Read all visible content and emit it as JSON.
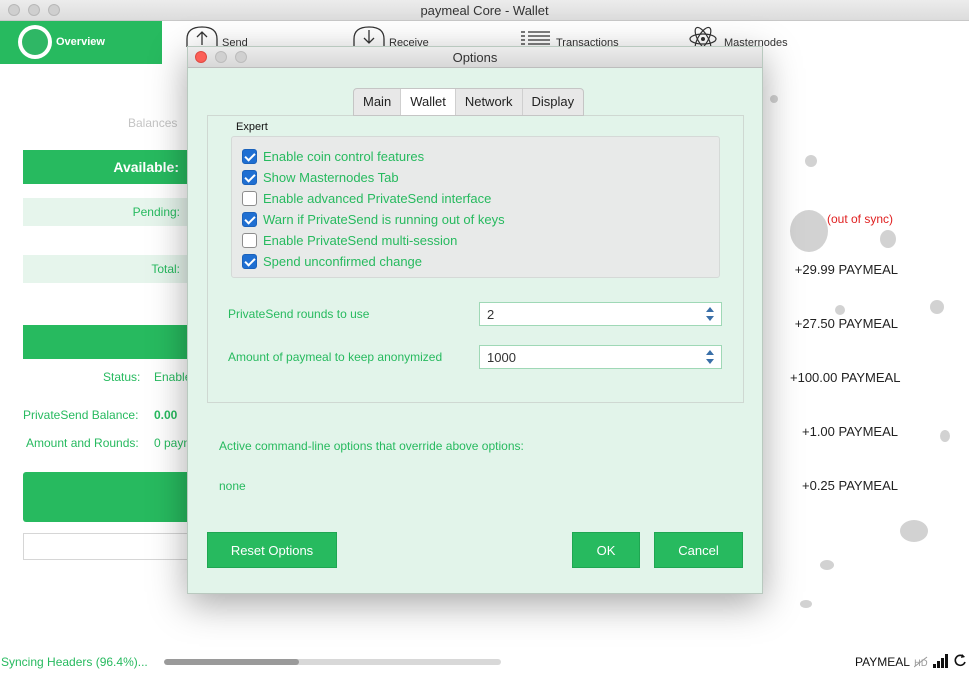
{
  "window": {
    "title": "paymeal Core - Wallet"
  },
  "toolbar": {
    "overview": "Overview",
    "send": "Send",
    "receive": "Receive",
    "transactions": "Transactions",
    "masternodes": "Masternodes"
  },
  "overview": {
    "balances_label": "Balances",
    "available_label": "Available:",
    "pending_label": "Pending:",
    "total_label": "Total:",
    "status_label": "Status:",
    "status_value": "Enable",
    "ps_balance_label": "PrivateSend Balance:",
    "ps_balance_value": "0.00",
    "amount_rounds_label": "Amount and Rounds:",
    "amount_rounds_value": "0 payn",
    "out_of_sync": "(out of sync)",
    "transactions": [
      "+29.99 PAYMEAL",
      "+27.50 PAYMEAL",
      "+100.00 PAYMEAL",
      "+1.00 PAYMEAL",
      "+0.25 PAYMEAL"
    ]
  },
  "statusbar": {
    "sync_text": "Syncing Headers (96.4%)...",
    "sync_progress": 0.4,
    "unit": "PAYMEAL"
  },
  "dialog": {
    "title": "Options",
    "tabs": [
      {
        "label": "Main",
        "active": false
      },
      {
        "label": "Wallet",
        "active": true
      },
      {
        "label": "Network",
        "active": false
      },
      {
        "label": "Display",
        "active": false
      }
    ],
    "expert_label": "Expert",
    "checkboxes": [
      {
        "label": "Enable coin control features",
        "checked": true
      },
      {
        "label": "Show Masternodes Tab",
        "checked": true
      },
      {
        "label": "Enable advanced PrivateSend interface",
        "checked": false
      },
      {
        "label": "Warn if PrivateSend is running out of keys",
        "checked": true
      },
      {
        "label": "Enable PrivateSend multi-session",
        "checked": false
      },
      {
        "label": "Spend unconfirmed change",
        "checked": true
      }
    ],
    "rounds_label": "PrivateSend rounds to use",
    "rounds_value": "2",
    "anon_label": "Amount of paymeal to keep anonymized",
    "anon_value": "1000",
    "override_label": "Active command-line options that override above options:",
    "override_value": "none",
    "reset_button": "Reset Options",
    "ok_button": "OK",
    "cancel_button": "Cancel"
  },
  "colors": {
    "accent": "#27ba5f",
    "light_accent": "#e2f4ea",
    "out_of_sync": "#e02020"
  }
}
